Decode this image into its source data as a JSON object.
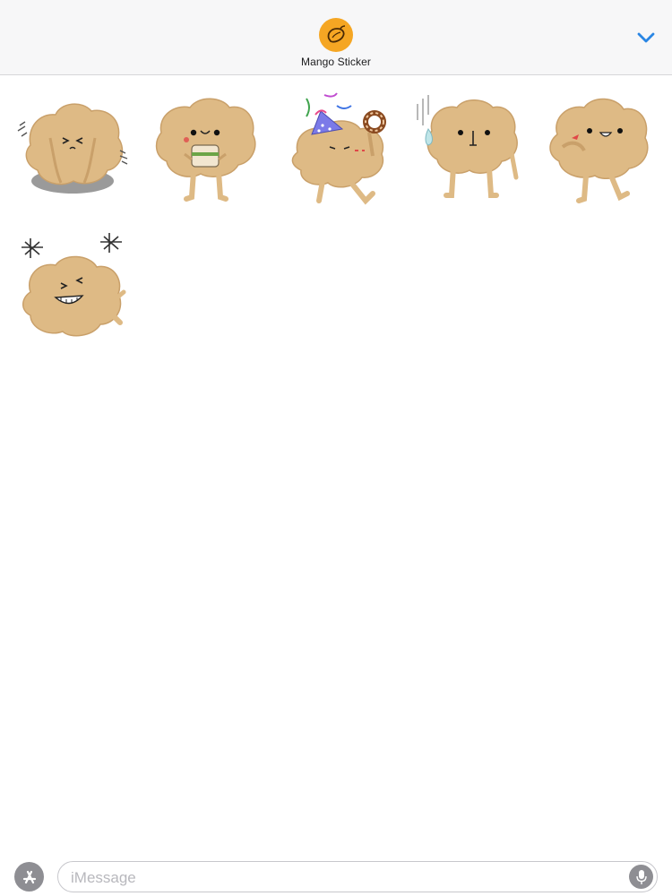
{
  "header": {
    "app_name": "Mango Sticker",
    "app_icon": "mango-icon",
    "collapse_icon": "chevron-down-icon",
    "accent_color": "#2a86e4",
    "icon_bg_color": "#f5a623"
  },
  "stickers": [
    {
      "name": "sticker-shy-on-cushion"
    },
    {
      "name": "sticker-eating-sandwich"
    },
    {
      "name": "sticker-party-donut"
    },
    {
      "name": "sticker-nervous-sweat"
    },
    {
      "name": "sticker-thumbs-up-chat"
    },
    {
      "name": "sticker-laughing-rolling"
    }
  ],
  "input_bar": {
    "placeholder": "iMessage",
    "app_store_icon": "app-store-icon",
    "mic_icon": "microphone-icon"
  }
}
